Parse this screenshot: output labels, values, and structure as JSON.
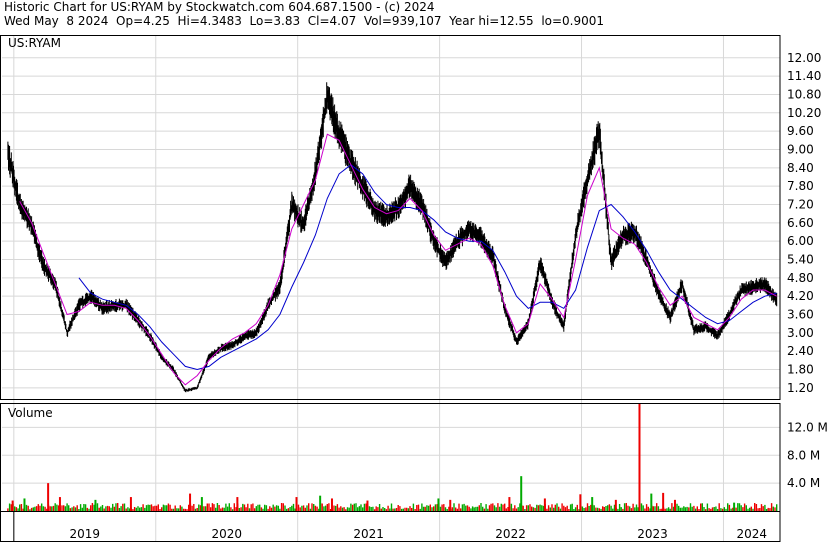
{
  "header": {
    "line1": "Historic Chart for US:RYAM by Stockwatch.com 604.687.1500 - (c) 2024",
    "line2": "Wed May  8 2024  Op=4.25  Hi=4.3483  Lo=3.83  Cl=4.07  Vol=939,107  Year hi=12.55  lo=0.9001"
  },
  "colors": {
    "price": "#000000",
    "ma_short": "#cc00cc",
    "ma_long": "#0000cc",
    "vol_up": "#00aa00",
    "vol_down": "#ee0000",
    "grid": "#d8d8d8",
    "axis": "#000000"
  },
  "chart_data": [
    {
      "type": "line",
      "title": "US:RYAM",
      "y_ticks": [
        "12.00",
        "11.40",
        "10.80",
        "10.20",
        "9.60",
        "9.00",
        "8.40",
        "7.80",
        "7.20",
        "6.60",
        "6.00",
        "5.40",
        "4.80",
        "4.20",
        "3.60",
        "3.00",
        "2.40",
        "1.80",
        "1.20"
      ],
      "ylim": [
        0.9,
        12.55
      ],
      "x_labels": [
        "2019",
        "2020",
        "2021",
        "2022",
        "2023",
        "2024"
      ],
      "x_range": [
        "2018-12",
        "2024-05"
      ],
      "grid": true,
      "series": [
        {
          "role": "price",
          "points": [
            [
              "2018-12",
              8.9
            ],
            [
              "2019-01",
              7.2
            ],
            [
              "2019-02",
              6.5
            ],
            [
              "2019-03",
              5.2
            ],
            [
              "2019-04",
              4.6
            ],
            [
              "2019-05",
              3.0
            ],
            [
              "2019-06",
              3.9
            ],
            [
              "2019-07",
              4.2
            ],
            [
              "2019-08",
              3.8
            ],
            [
              "2019-09",
              3.9
            ],
            [
              "2019-10",
              3.9
            ],
            [
              "2019-11",
              3.4
            ],
            [
              "2019-12",
              2.9
            ],
            [
              "2020-01",
              2.2
            ],
            [
              "2020-02",
              1.8
            ],
            [
              "2020-03",
              1.1
            ],
            [
              "2020-04",
              1.2
            ],
            [
              "2020-05",
              2.2
            ],
            [
              "2020-06",
              2.5
            ],
            [
              "2020-07",
              2.6
            ],
            [
              "2020-08",
              2.9
            ],
            [
              "2020-09",
              3.0
            ],
            [
              "2020-10",
              3.9
            ],
            [
              "2020-11",
              4.5
            ],
            [
              "2020-12",
              7.2
            ],
            [
              "2021-01",
              6.5
            ],
            [
              "2021-02",
              8.2
            ],
            [
              "2021-03",
              10.8
            ],
            [
              "2021-04",
              9.5
            ],
            [
              "2021-05",
              8.6
            ],
            [
              "2021-06",
              7.8
            ],
            [
              "2021-07",
              7.0
            ],
            [
              "2021-08",
              6.8
            ],
            [
              "2021-09",
              7.1
            ],
            [
              "2021-10",
              7.8
            ],
            [
              "2021-11",
              7.2
            ],
            [
              "2021-12",
              6.0
            ],
            [
              "2022-01",
              5.3
            ],
            [
              "2022-02",
              6.0
            ],
            [
              "2022-03",
              6.4
            ],
            [
              "2022-04",
              6.1
            ],
            [
              "2022-05",
              5.5
            ],
            [
              "2022-06",
              3.8
            ],
            [
              "2022-07",
              2.7
            ],
            [
              "2022-08",
              3.3
            ],
            [
              "2022-09",
              5.3
            ],
            [
              "2022-10",
              4.0
            ],
            [
              "2022-11",
              3.2
            ],
            [
              "2022-12",
              6.2
            ],
            [
              "2023-01",
              8.0
            ],
            [
              "2023-02",
              9.6
            ],
            [
              "2023-03",
              5.3
            ],
            [
              "2023-04",
              6.2
            ],
            [
              "2023-05",
              6.3
            ],
            [
              "2023-06",
              5.4
            ],
            [
              "2023-07",
              4.3
            ],
            [
              "2023-08",
              3.5
            ],
            [
              "2023-09",
              4.6
            ],
            [
              "2023-10",
              3.1
            ],
            [
              "2023-11",
              3.2
            ],
            [
              "2023-12",
              2.9
            ],
            [
              "2024-01",
              3.6
            ],
            [
              "2024-02",
              4.4
            ],
            [
              "2024-03",
              4.5
            ],
            [
              "2024-04",
              4.6
            ],
            [
              "2024-05",
              4.07
            ]
          ]
        },
        {
          "role": "ma_short",
          "points": [
            [
              "2019-01",
              7.3
            ],
            [
              "2019-02",
              6.6
            ],
            [
              "2019-03",
              5.6
            ],
            [
              "2019-04",
              4.6
            ],
            [
              "2019-05",
              3.6
            ],
            [
              "2019-06",
              3.7
            ],
            [
              "2019-07",
              4.0
            ],
            [
              "2019-08",
              3.9
            ],
            [
              "2019-09",
              3.9
            ],
            [
              "2019-10",
              3.8
            ],
            [
              "2019-11",
              3.4
            ],
            [
              "2019-12",
              2.9
            ],
            [
              "2020-01",
              2.3
            ],
            [
              "2020-02",
              1.7
            ],
            [
              "2020-03",
              1.3
            ],
            [
              "2020-04",
              1.6
            ],
            [
              "2020-05",
              2.1
            ],
            [
              "2020-06",
              2.5
            ],
            [
              "2020-07",
              2.8
            ],
            [
              "2020-08",
              3.0
            ],
            [
              "2020-09",
              3.3
            ],
            [
              "2020-10",
              3.9
            ],
            [
              "2020-11",
              4.9
            ],
            [
              "2020-12",
              6.4
            ],
            [
              "2021-01",
              7.2
            ],
            [
              "2021-02",
              8.0
            ],
            [
              "2021-03",
              9.5
            ],
            [
              "2021-04",
              9.3
            ],
            [
              "2021-05",
              8.5
            ],
            [
              "2021-06",
              7.7
            ],
            [
              "2021-07",
              7.1
            ],
            [
              "2021-08",
              6.9
            ],
            [
              "2021-09",
              7.0
            ],
            [
              "2021-10",
              7.4
            ],
            [
              "2021-11",
              7.0
            ],
            [
              "2021-12",
              6.2
            ],
            [
              "2022-01",
              5.7
            ],
            [
              "2022-02",
              5.9
            ],
            [
              "2022-03",
              6.1
            ],
            [
              "2022-04",
              5.9
            ],
            [
              "2022-05",
              5.2
            ],
            [
              "2022-06",
              3.9
            ],
            [
              "2022-07",
              3.0
            ],
            [
              "2022-08",
              3.3
            ],
            [
              "2022-09",
              4.6
            ],
            [
              "2022-10",
              4.1
            ],
            [
              "2022-11",
              3.5
            ],
            [
              "2022-12",
              5.4
            ],
            [
              "2023-01",
              7.5
            ],
            [
              "2023-02",
              8.4
            ],
            [
              "2023-03",
              6.4
            ],
            [
              "2023-04",
              6.1
            ],
            [
              "2023-05",
              5.9
            ],
            [
              "2023-06",
              5.3
            ],
            [
              "2023-07",
              4.5
            ],
            [
              "2023-08",
              3.9
            ],
            [
              "2023-09",
              4.2
            ],
            [
              "2023-10",
              3.5
            ],
            [
              "2023-11",
              3.3
            ],
            [
              "2023-12",
              3.1
            ],
            [
              "2024-01",
              3.5
            ],
            [
              "2024-02",
              4.1
            ],
            [
              "2024-03",
              4.4
            ],
            [
              "2024-04",
              4.4
            ],
            [
              "2024-05",
              4.2
            ]
          ]
        },
        {
          "role": "ma_long",
          "points": [
            [
              "2019-06",
              4.8
            ],
            [
              "2019-07",
              4.3
            ],
            [
              "2019-08",
              4.1
            ],
            [
              "2019-09",
              4.0
            ],
            [
              "2019-10",
              3.9
            ],
            [
              "2019-11",
              3.6
            ],
            [
              "2019-12",
              3.2
            ],
            [
              "2020-01",
              2.7
            ],
            [
              "2020-02",
              2.3
            ],
            [
              "2020-03",
              1.9
            ],
            [
              "2020-04",
              1.8
            ],
            [
              "2020-05",
              1.9
            ],
            [
              "2020-06",
              2.2
            ],
            [
              "2020-07",
              2.4
            ],
            [
              "2020-08",
              2.6
            ],
            [
              "2020-09",
              2.8
            ],
            [
              "2020-10",
              3.1
            ],
            [
              "2020-11",
              3.6
            ],
            [
              "2020-12",
              4.5
            ],
            [
              "2021-01",
              5.3
            ],
            [
              "2021-02",
              6.2
            ],
            [
              "2021-03",
              7.4
            ],
            [
              "2021-04",
              8.2
            ],
            [
              "2021-05",
              8.5
            ],
            [
              "2021-06",
              8.2
            ],
            [
              "2021-07",
              7.6
            ],
            [
              "2021-08",
              7.2
            ],
            [
              "2021-09",
              7.1
            ],
            [
              "2021-10",
              7.1
            ],
            [
              "2021-11",
              7.0
            ],
            [
              "2021-12",
              6.7
            ],
            [
              "2022-01",
              6.3
            ],
            [
              "2022-02",
              6.1
            ],
            [
              "2022-03",
              6.0
            ],
            [
              "2022-04",
              6.0
            ],
            [
              "2022-05",
              5.7
            ],
            [
              "2022-06",
              5.0
            ],
            [
              "2022-07",
              4.2
            ],
            [
              "2022-08",
              3.8
            ],
            [
              "2022-09",
              4.0
            ],
            [
              "2022-10",
              4.0
            ],
            [
              "2022-11",
              3.8
            ],
            [
              "2022-12",
              4.4
            ],
            [
              "2023-01",
              5.8
            ],
            [
              "2023-02",
              7.0
            ],
            [
              "2023-03",
              7.2
            ],
            [
              "2023-04",
              6.8
            ],
            [
              "2023-05",
              6.3
            ],
            [
              "2023-06",
              5.7
            ],
            [
              "2023-07",
              5.0
            ],
            [
              "2023-08",
              4.4
            ],
            [
              "2023-09",
              4.1
            ],
            [
              "2023-10",
              3.8
            ],
            [
              "2023-11",
              3.5
            ],
            [
              "2023-12",
              3.3
            ],
            [
              "2024-01",
              3.4
            ],
            [
              "2024-02",
              3.7
            ],
            [
              "2024-03",
              4.0
            ],
            [
              "2024-04",
              4.2
            ],
            [
              "2024-05",
              4.3
            ]
          ]
        }
      ]
    },
    {
      "type": "bar",
      "title": "Volume",
      "y_ticks": [
        "12.0 M",
        "8.0 M",
        "4.0 M"
      ],
      "ylim": [
        0,
        15.5
      ],
      "unit": "M",
      "spikes": [
        [
          "2018-12",
          1.5
        ],
        [
          "2019-01",
          1.8
        ],
        [
          "2019-03",
          4.0
        ],
        [
          "2019-04",
          2.0
        ],
        [
          "2019-07",
          1.6
        ],
        [
          "2019-10",
          2.0
        ],
        [
          "2020-03",
          2.5
        ],
        [
          "2020-04",
          2.0
        ],
        [
          "2020-07",
          2.0
        ],
        [
          "2020-12",
          2.0
        ],
        [
          "2021-02",
          2.2
        ],
        [
          "2021-03",
          1.8
        ],
        [
          "2021-06",
          1.5
        ],
        [
          "2021-12",
          1.8
        ],
        [
          "2022-01",
          1.6
        ],
        [
          "2022-06",
          2.0
        ],
        [
          "2022-07",
          5.0
        ],
        [
          "2022-09",
          1.8
        ],
        [
          "2022-12",
          2.4
        ],
        [
          "2023-01",
          2.0
        ],
        [
          "2023-03",
          1.6
        ],
        [
          "2023-05",
          15.5
        ],
        [
          "2023-06",
          2.5
        ],
        [
          "2023-07",
          2.6
        ],
        [
          "2023-08",
          1.6
        ],
        [
          "2024-01",
          1.2
        ]
      ]
    }
  ]
}
